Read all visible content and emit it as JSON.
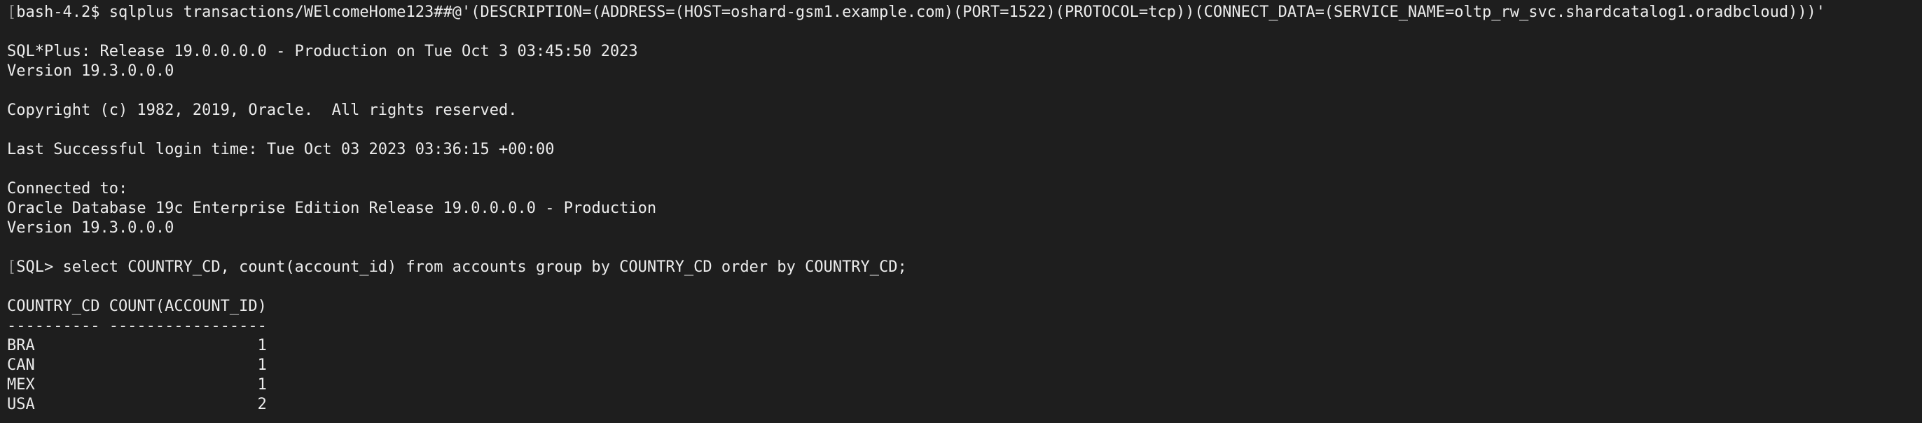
{
  "terminal": {
    "lines": [
      {
        "bracket": "[",
        "text": "bash-4.2$ sqlplus transactions/WElcomeHome123##@'(DESCRIPTION=(ADDRESS=(HOST=oshard-gsm1.example.com)(PORT=1522)(PROTOCOL=tcp))(CONNECT_DATA=(SERVICE_NAME=oltp_rw_svc.shardcatalog1.oradbcloud)))'"
      },
      {
        "bracket": "",
        "text": ""
      },
      {
        "bracket": "",
        "text": "SQL*Plus: Release 19.0.0.0.0 - Production on Tue Oct 3 03:45:50 2023"
      },
      {
        "bracket": "",
        "text": "Version 19.3.0.0.0"
      },
      {
        "bracket": "",
        "text": ""
      },
      {
        "bracket": "",
        "text": "Copyright (c) 1982, 2019, Oracle.  All rights reserved."
      },
      {
        "bracket": "",
        "text": ""
      },
      {
        "bracket": "",
        "text": "Last Successful login time: Tue Oct 03 2023 03:36:15 +00:00"
      },
      {
        "bracket": "",
        "text": ""
      },
      {
        "bracket": "",
        "text": "Connected to:"
      },
      {
        "bracket": "",
        "text": "Oracle Database 19c Enterprise Edition Release 19.0.0.0.0 - Production"
      },
      {
        "bracket": "",
        "text": "Version 19.3.0.0.0"
      },
      {
        "bracket": "",
        "text": ""
      },
      {
        "bracket": "[",
        "text": "SQL> select COUNTRY_CD, count(account_id) from accounts group by COUNTRY_CD order by COUNTRY_CD;"
      },
      {
        "bracket": "",
        "text": ""
      },
      {
        "bracket": "",
        "text": "COUNTRY_CD COUNT(ACCOUNT_ID)"
      },
      {
        "bracket": "",
        "text": "---------- -----------------"
      },
      {
        "bracket": "",
        "text": "BRA                        1"
      },
      {
        "bracket": "",
        "text": "CAN                        1"
      },
      {
        "bracket": "",
        "text": "MEX                        1"
      },
      {
        "bracket": "",
        "text": "USA                        2"
      }
    ]
  }
}
